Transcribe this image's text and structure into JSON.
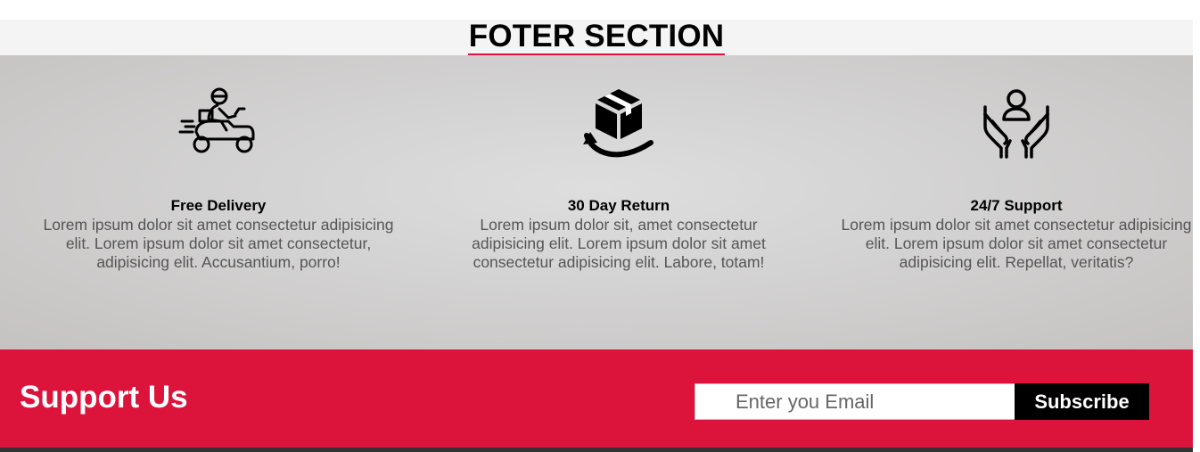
{
  "section": {
    "title": "FOTER SECTION",
    "accent_color": "#dc143c"
  },
  "features": [
    {
      "icon": "delivery-scooter-icon",
      "title": "Free Delivery",
      "text": "Lorem ipsum dolor sit amet consectetur adipisicing elit. Lorem ipsum dolor sit amet consectetur, adipisicing elit. Accusantium, porro!"
    },
    {
      "icon": "box-return-icon",
      "title": "30 Day Return",
      "text": "Lorem ipsum dolor sit, amet consectetur adipisicing elit. Lorem ipsum dolor sit amet consectetur adipisicing elit. Labore, totam!"
    },
    {
      "icon": "support-hands-icon",
      "title": "24/7 Support",
      "text": "Lorem ipsum dolor sit amet consectetur adipisicing elit. Lorem ipsum dolor sit amet consectetur adipisicing elit. Repellat, veritatis?"
    }
  ],
  "support": {
    "title": "Support Us",
    "email_placeholder": "Enter you Email",
    "email_value": "",
    "subscribe_label": "Subscribe",
    "background_color": "#dc143c"
  }
}
